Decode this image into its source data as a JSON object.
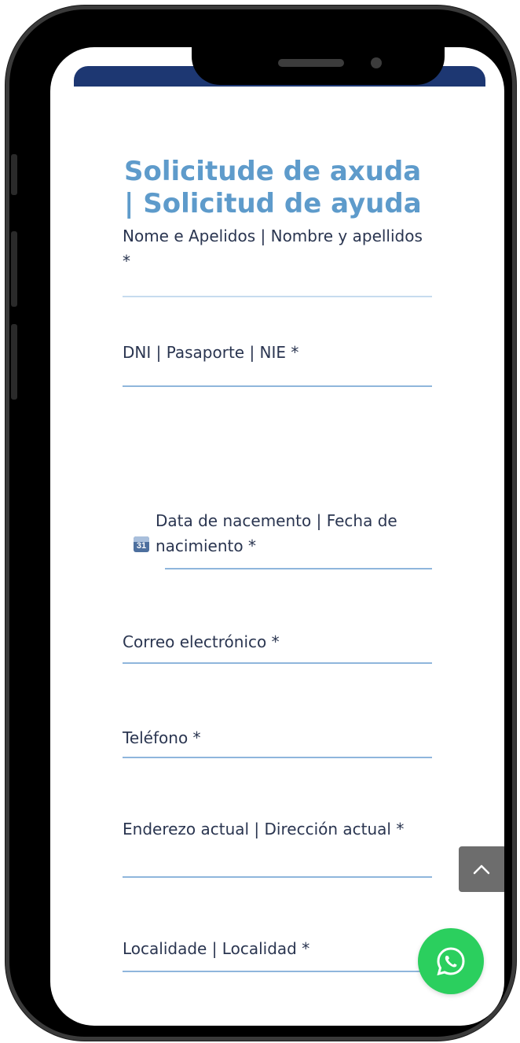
{
  "form": {
    "title": "Solicitude de axuda | Solicitud de ayuda",
    "fields": [
      {
        "label": "Nome e Apelidos | Nombre y apellidos *"
      },
      {
        "label": "DNI | Pasaporte | NIE *"
      },
      {
        "label": "Data de nacemento | Fecha de nacimiento *",
        "icon": "calendar-icon",
        "icon_text": "31"
      },
      {
        "label": "Correo electrónico *"
      },
      {
        "label": "Teléfono *"
      },
      {
        "label": "Enderezo actual | Dirección actual *"
      },
      {
        "label": "Localidade | Localidad *"
      }
    ]
  },
  "floating": {
    "scroll_top_icon": "chevron-up-icon",
    "whatsapp_icon": "whatsapp-icon"
  },
  "colors": {
    "header_bar": "#1d3772",
    "title": "#5e9bcb",
    "whatsapp": "#2bcf5e",
    "scroll_top": "#6d6d6d"
  }
}
